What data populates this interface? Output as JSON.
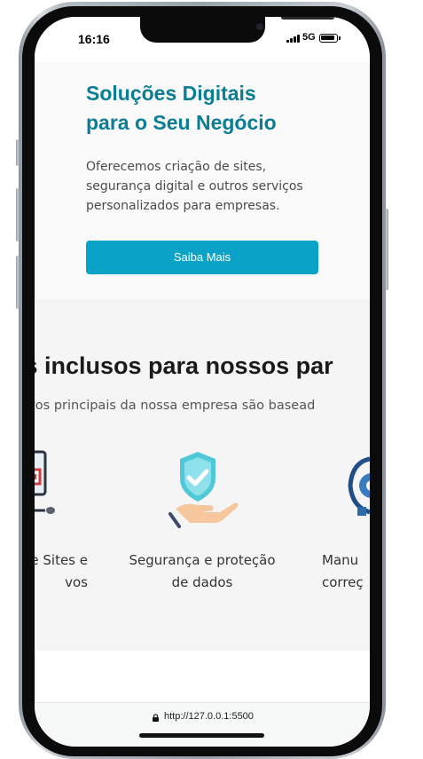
{
  "status_bar": {
    "time": "16:16",
    "network": "5G",
    "signal_icon": "signal-bars-icon",
    "battery_icon": "battery-icon"
  },
  "hero": {
    "title_line1": "Soluções Digitais",
    "title_line2": "para o Seu Negócio",
    "description": "Oferecemos criação de sites, segurança digital e outros serviços personalizados para empresas.",
    "cta_label": "Saiba Mais",
    "accent_color": "#0b7d94",
    "button_color": "#0aa3c7"
  },
  "services": {
    "title": "os inclusos para nossos par",
    "subtitle": "amentos principais da nossa empresa são basead",
    "cards": [
      {
        "icon": "computer-icon",
        "label_line1": "e Sites e",
        "label_line2": "vos"
      },
      {
        "icon": "shield-hand-icon",
        "label_line1": "Segurança e proteção",
        "label_line2": "de dados"
      },
      {
        "icon": "maintenance-gear-icon",
        "label_line1": "Manu",
        "label_line2": "correç"
      }
    ]
  },
  "browser": {
    "url": "http://127.0.0.1:5500",
    "lock_icon": "lock-icon"
  }
}
